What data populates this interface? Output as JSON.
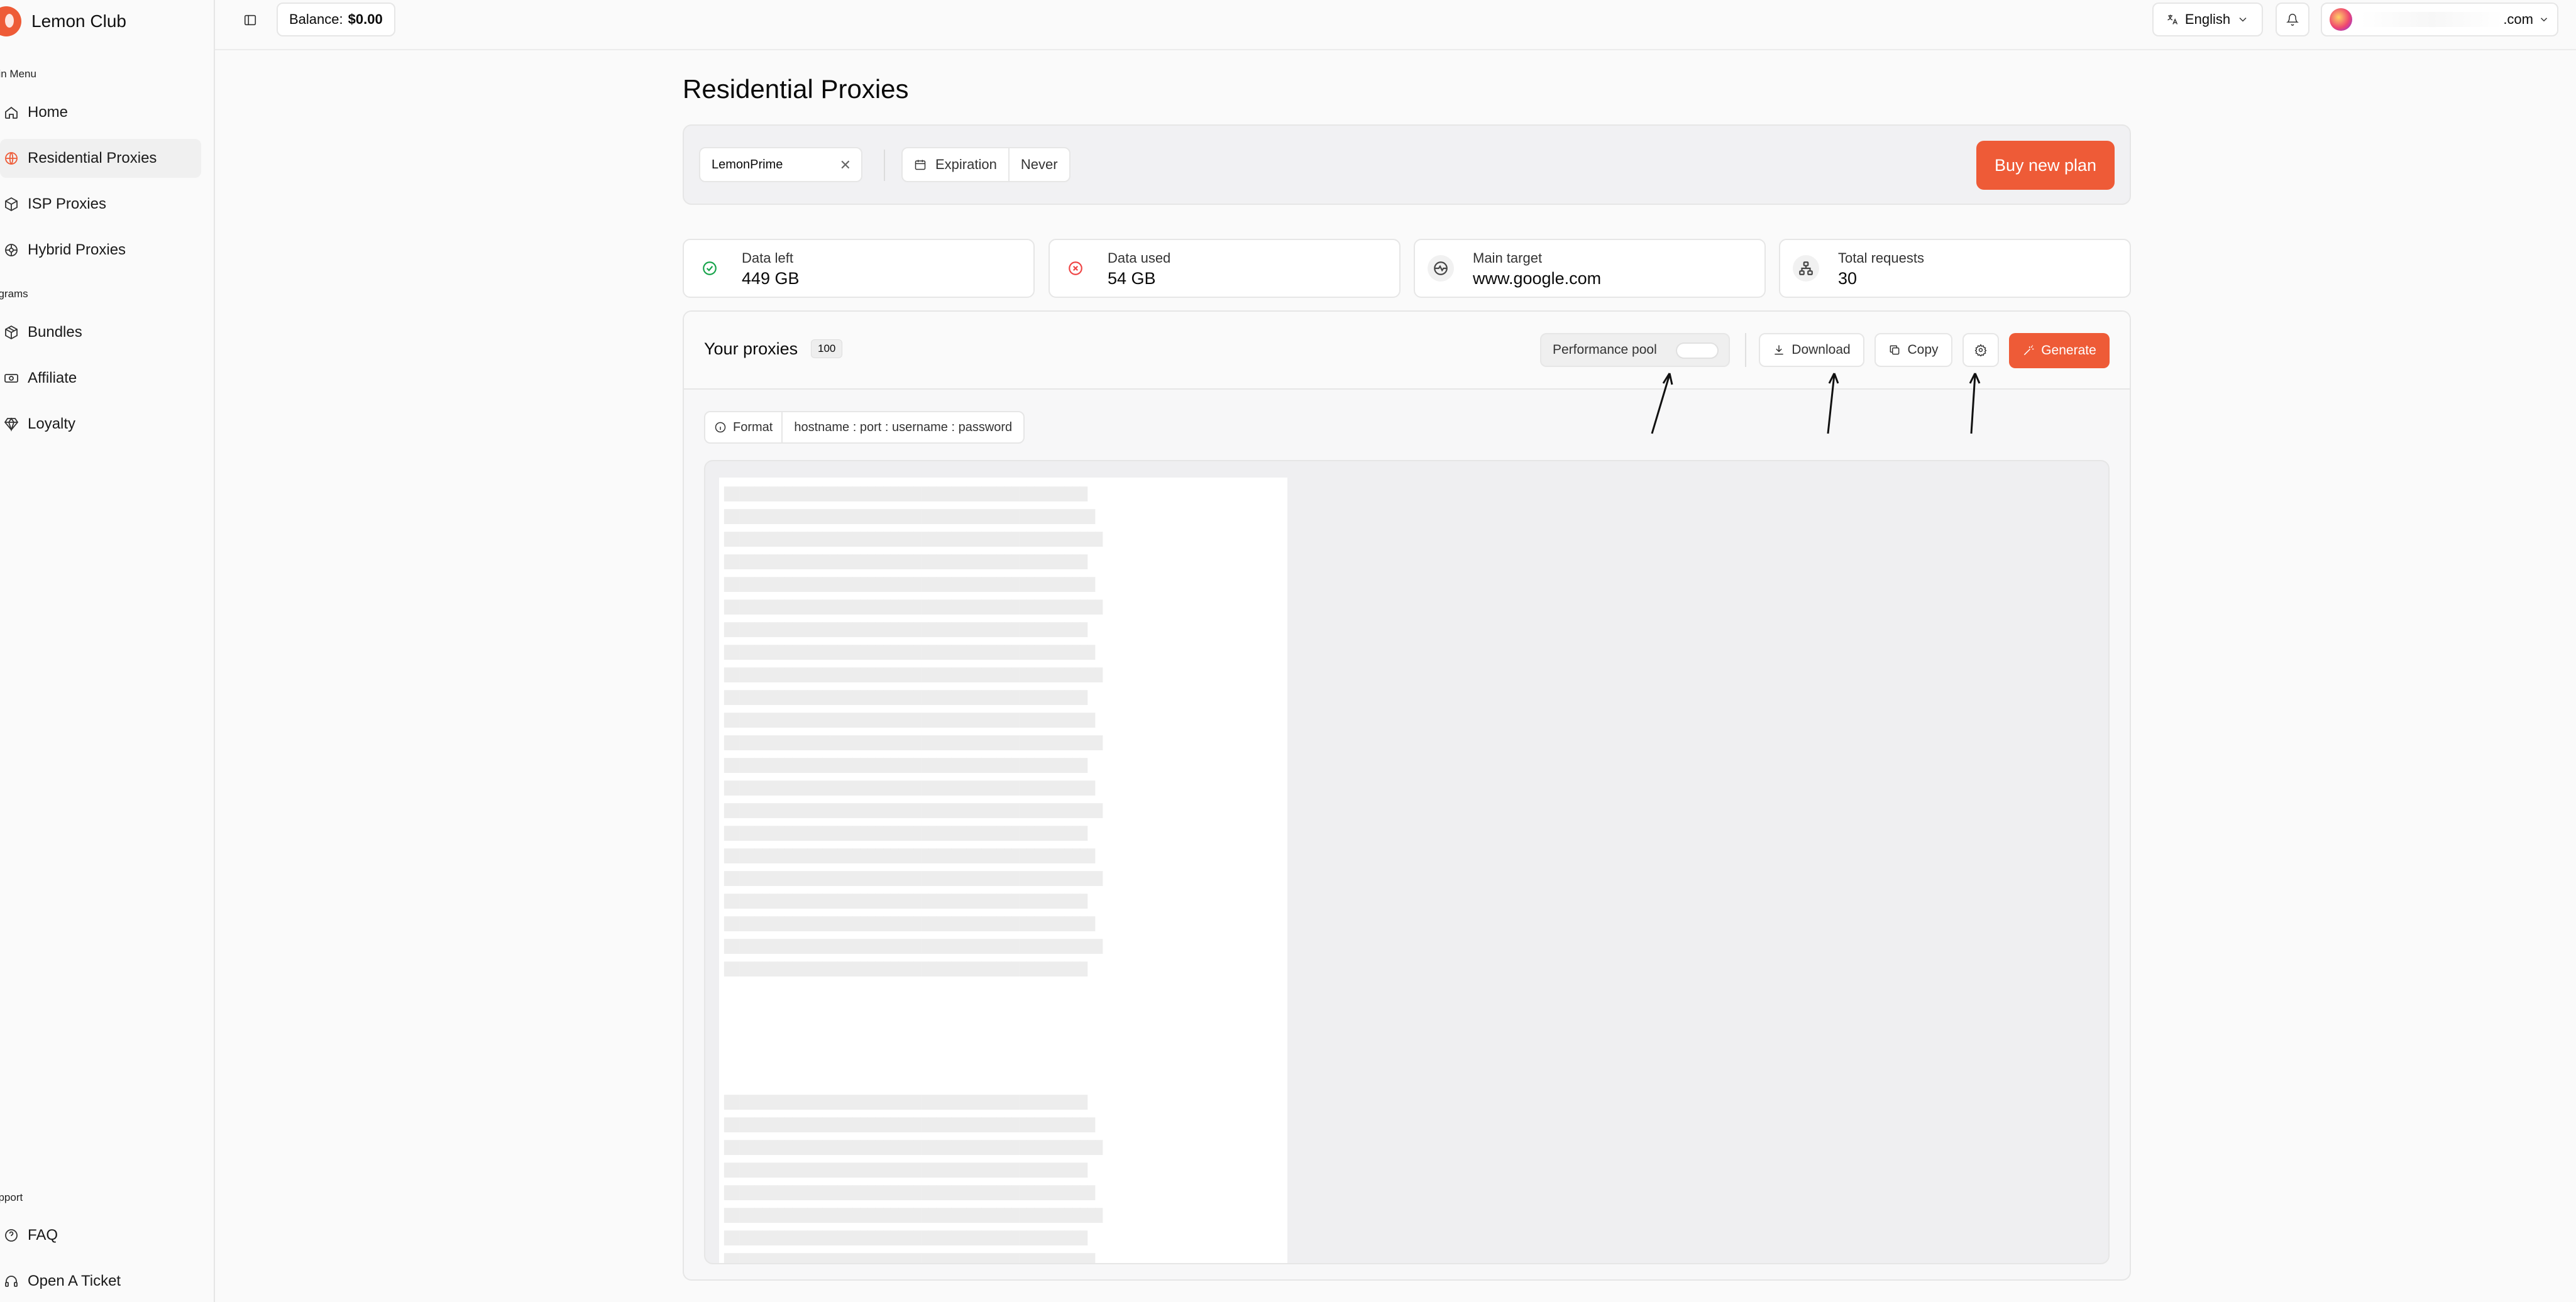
{
  "app": {
    "name": "Lemon Club"
  },
  "sidebar": {
    "section_main": "ain Menu",
    "main_items": [
      {
        "label": "Home",
        "icon": "home-icon"
      },
      {
        "label": "Residential Proxies",
        "icon": "globe-icon",
        "active": true
      },
      {
        "label": "ISP Proxies",
        "icon": "box-icon"
      },
      {
        "label": "Hybrid Proxies",
        "icon": "hybrid-icon"
      }
    ],
    "section_programs": "ograms",
    "program_items": [
      {
        "label": "Bundles",
        "icon": "package-icon"
      },
      {
        "label": "Affiliate",
        "icon": "banknote-icon"
      },
      {
        "label": "Loyalty",
        "icon": "gem-icon"
      }
    ],
    "section_support": "upport",
    "support_items": [
      {
        "label": "FAQ",
        "icon": "help-circle-icon"
      },
      {
        "label": "Open A Ticket",
        "icon": "headset-icon"
      }
    ]
  },
  "topbar": {
    "balance_label": "Balance:",
    "balance_value": "$0.00",
    "language": "English",
    "user_email_suffix": ".com"
  },
  "page": {
    "title": "Residential Proxies",
    "plan": {
      "selected": "LemonPrime",
      "expiration_label": "Expiration",
      "expiration_value": "Never",
      "buy_button": "Buy new plan"
    },
    "stats": [
      {
        "label": "Data left",
        "value": "449 GB",
        "icon": "check-circle-icon",
        "color": "#16a34a"
      },
      {
        "label": "Data used",
        "value": "54 GB",
        "icon": "x-circle-icon",
        "color": "#ef4444"
      },
      {
        "label": "Main target",
        "value": "www.google.com",
        "icon": "target-globe-icon",
        "color": "#444444"
      },
      {
        "label": "Total requests",
        "value": "30",
        "icon": "network-icon",
        "color": "#444444"
      }
    ],
    "proxies": {
      "title": "Your proxies",
      "count": "100",
      "performance_pool_label": "Performance pool",
      "performance_pool_enabled": false,
      "download_label": "Download",
      "copy_label": "Copy",
      "generate_label": "Generate",
      "format_label": "Format",
      "format_value": "hostname : port : username : password"
    }
  },
  "colors": {
    "accent": "#ee5b37",
    "success": "#16a34a",
    "danger": "#ef4444"
  }
}
